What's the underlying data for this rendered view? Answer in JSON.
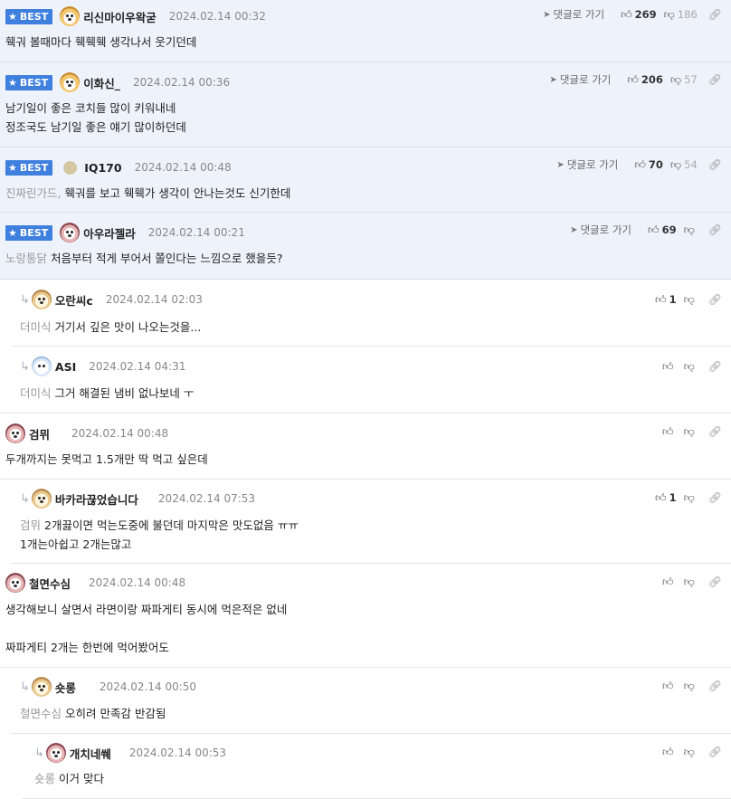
{
  "best_badge": "BEST",
  "goto_label": "댓글로 가기",
  "comments": [
    {
      "nick": "리신마이우왁굳",
      "date": "2024.02.14 00:32",
      "up": "269",
      "down": "186",
      "body1": "훽궈 볼때마다 훽훽훽 생각나서 웃기던데"
    },
    {
      "nick": "이화신_",
      "date": "2024.02.14 00:36",
      "up": "206",
      "down": "57",
      "body1": "남기일이 좋은 코치들 많이 키워내네",
      "body2": "정조국도 남기일 좋은 얘기 많이하던데"
    },
    {
      "nick": "IQ170",
      "date": "2024.02.14 00:48",
      "up": "70",
      "down": "54",
      "mention": "진짜린가드,",
      "body1": "훽궈를 보고 훽훽가 생각이 안나는것도 신기한데"
    },
    {
      "nick": "아우라젤라",
      "date": "2024.02.14 00:21",
      "up": "69",
      "mention": "노랑통닭",
      "body1": "처음부터 적게 부어서 쫄인다는 느낌으로 했을듯?"
    },
    {
      "nick": "오란씨c",
      "date": "2024.02.14 02:03",
      "up": "1",
      "mention": "더미식",
      "body1": "거기서 깊은 맛이 나오는것을..."
    },
    {
      "nick": "ASI",
      "date": "2024.02.14 04:31",
      "mention": "더미식",
      "body1": "그거 해결된 냄비 없나보네 ㅜ"
    },
    {
      "nick": "검뮈",
      "date": "2024.02.14 00:48",
      "body1": "두개까지는 못먹고 1.5개만 딱 먹고 싶은데"
    },
    {
      "nick": "바카라끊었습니다",
      "date": "2024.02.14 07:53",
      "up": "1",
      "mention": "검뮈",
      "body1": "2개끓이면 먹는도중에 불던데 마지막은 맛도없음 ㅠㅠ",
      "body2": "1개는아쉽고 2개는많고"
    },
    {
      "nick": "철면수심",
      "date": "2024.02.14 00:48",
      "body1": "생각해보니 살면서 라면이랑 짜파게티 동시에 먹은적은 없네",
      "body2": "짜파게티 2개는 한번에 먹어봤어도"
    },
    {
      "nick": "숏롱",
      "date": "2024.02.14 00:50",
      "mention": "철면수심",
      "body1": "오히려 만족감 반감됨"
    },
    {
      "nick": "개치네쒜",
      "date": "2024.02.14 00:53",
      "mention": "숏롱",
      "body1": "이거 맞다"
    }
  ]
}
